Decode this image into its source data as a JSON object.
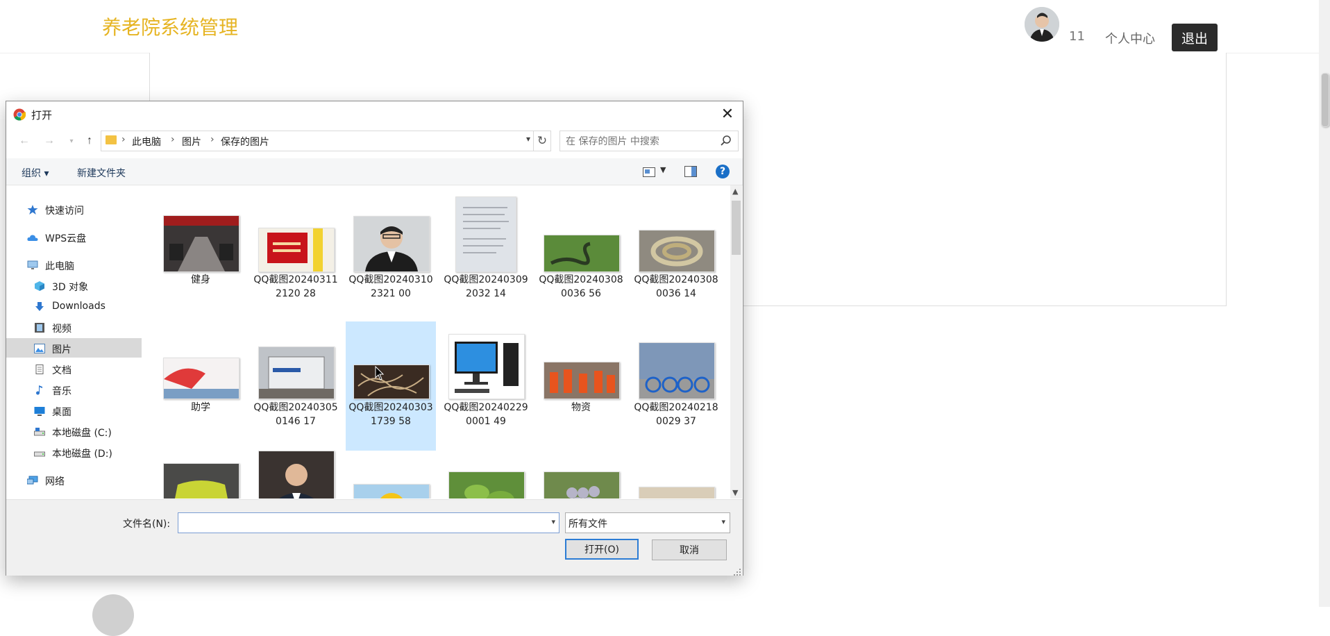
{
  "page": {
    "app_title": "养老院系统管理",
    "user_id": "11",
    "personal_center": "个人中心",
    "logout": "退出"
  },
  "dialog": {
    "title": "打开",
    "close_glyph": "✕",
    "breadcrumb": [
      "此电脑",
      "图片",
      "保存的图片"
    ],
    "search_placeholder": "在 保存的图片 中搜索",
    "toolbar": {
      "organize": "组织 ▾",
      "new_folder": "新建文件夹",
      "help": "?"
    },
    "nav_items": [
      {
        "label": "快速访问",
        "icon": "star-icon"
      },
      {
        "label": "WPS云盘",
        "icon": "cloud-icon"
      },
      {
        "label": "此电脑",
        "icon": "computer-icon"
      },
      {
        "label": "3D 对象",
        "icon": "cube-icon"
      },
      {
        "label": "Downloads",
        "icon": "download-icon"
      },
      {
        "label": "视频",
        "icon": "video-icon"
      },
      {
        "label": "图片",
        "icon": "picture-icon",
        "selected": true
      },
      {
        "label": "文档",
        "icon": "document-icon"
      },
      {
        "label": "音乐",
        "icon": "music-icon"
      },
      {
        "label": "桌面",
        "icon": "desktop-icon"
      },
      {
        "label": "本地磁盘 (C:)",
        "icon": "drive-icon"
      },
      {
        "label": "本地磁盘 (D:)",
        "icon": "drive-icon"
      },
      {
        "label": "网络",
        "icon": "network-icon"
      }
    ],
    "files": [
      {
        "label": "健身"
      },
      {
        "label": "QQ截图202403112120 28"
      },
      {
        "label": "QQ截图202403102321 00"
      },
      {
        "label": "QQ截图202403092032 14"
      },
      {
        "label": "QQ截图202403080036 56"
      },
      {
        "label": "QQ截图202403080036 14"
      },
      {
        "label": "助学"
      },
      {
        "label": "QQ截图202403050146 17"
      },
      {
        "label": "QQ截图202403031739 58",
        "selected": true
      },
      {
        "label": "QQ截图202402290001 49"
      },
      {
        "label": "物资"
      },
      {
        "label": "QQ截图202402180029 37"
      },
      {
        "label": ""
      },
      {
        "label": ""
      },
      {
        "label": ""
      },
      {
        "label": ""
      },
      {
        "label": ""
      },
      {
        "label": ""
      }
    ],
    "filename_label": "文件名(N):",
    "filename_value": "",
    "file_type": "所有文件",
    "open_button": "打开(O)",
    "cancel_button": "取消"
  },
  "colors": {
    "title_accent": "#e6b422",
    "selection": "#cce8ff",
    "primary_button_border": "#2c7cd4"
  }
}
